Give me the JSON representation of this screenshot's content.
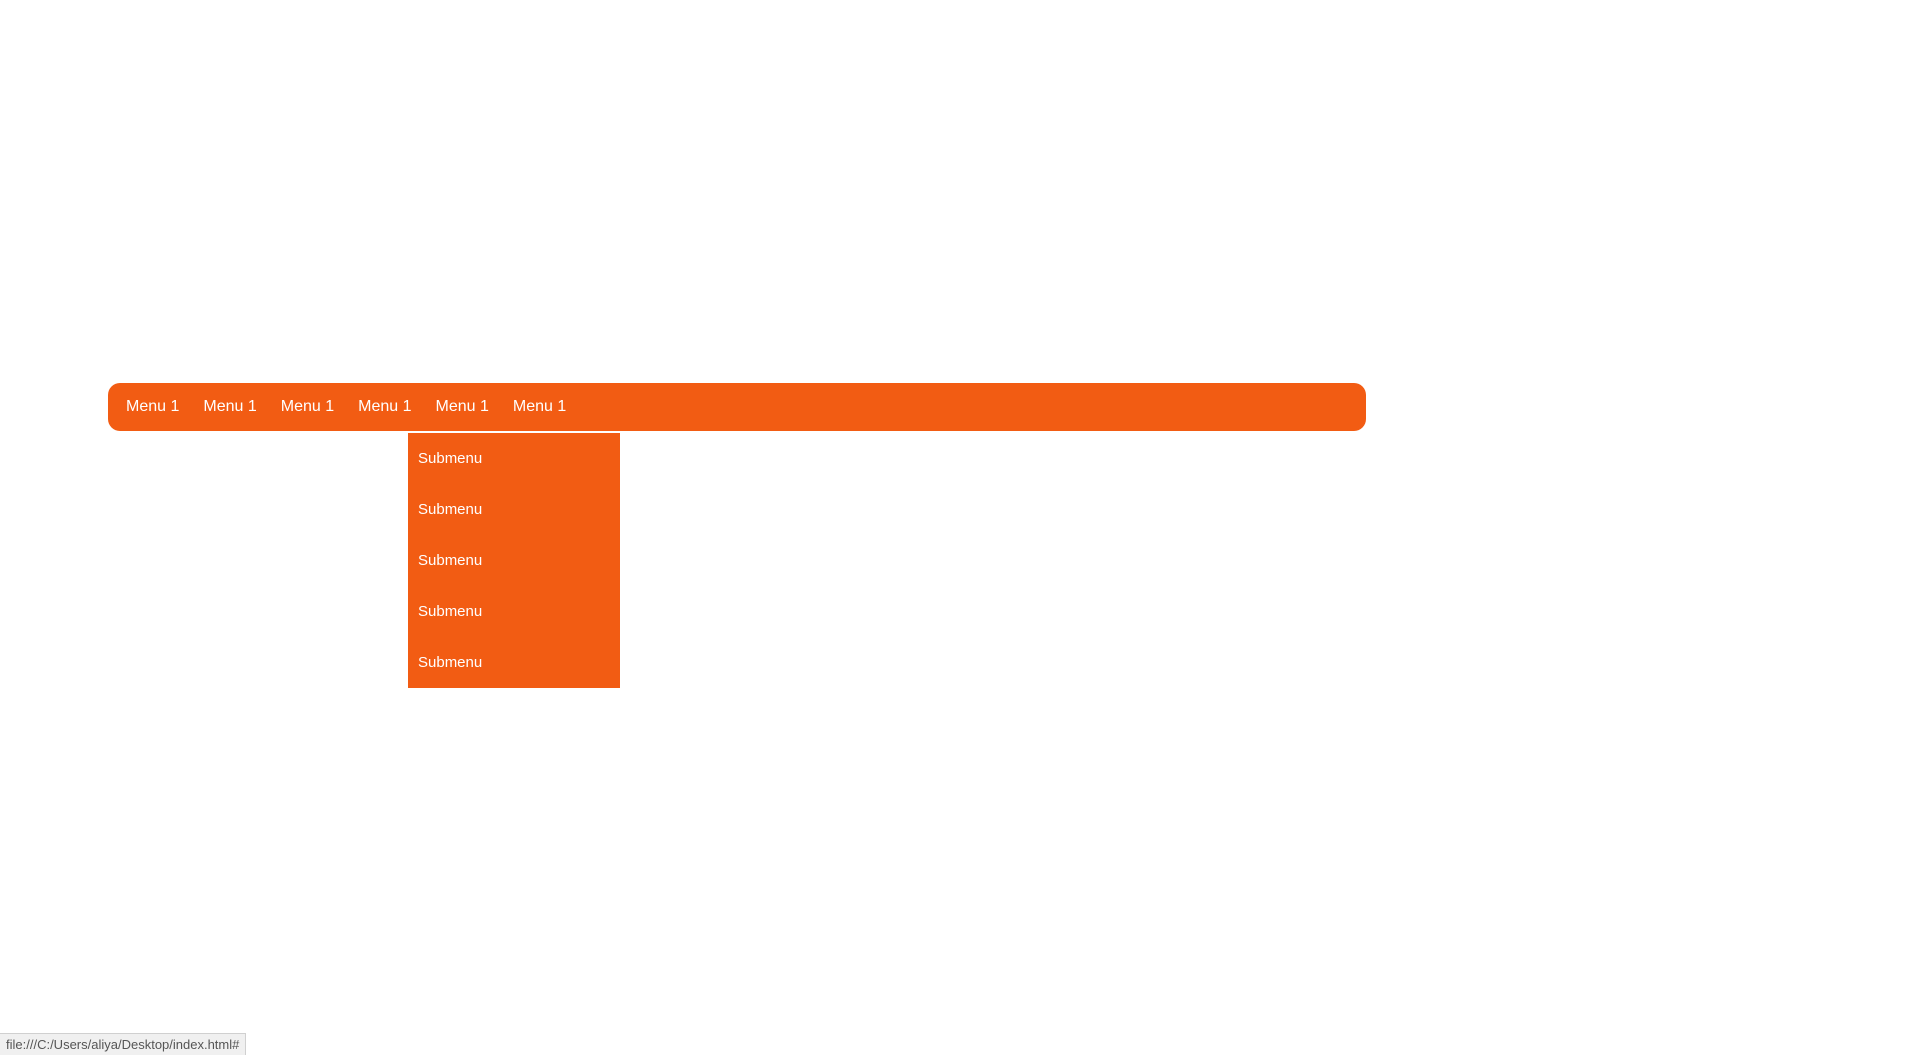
{
  "nav": {
    "items": [
      {
        "label": "Menu 1"
      },
      {
        "label": "Menu 1"
      },
      {
        "label": "Menu 1"
      },
      {
        "label": "Menu 1"
      },
      {
        "label": "Menu 1"
      },
      {
        "label": "Menu 1"
      }
    ]
  },
  "submenu": {
    "items": [
      {
        "label": "Submenu"
      },
      {
        "label": "Submenu"
      },
      {
        "label": "Submenu"
      },
      {
        "label": "Submenu"
      },
      {
        "label": "Submenu"
      }
    ]
  },
  "statusbar": {
    "text": "file:///C:/Users/aliya/Desktop/index.html#"
  },
  "colors": {
    "accent": "#f25c13"
  }
}
